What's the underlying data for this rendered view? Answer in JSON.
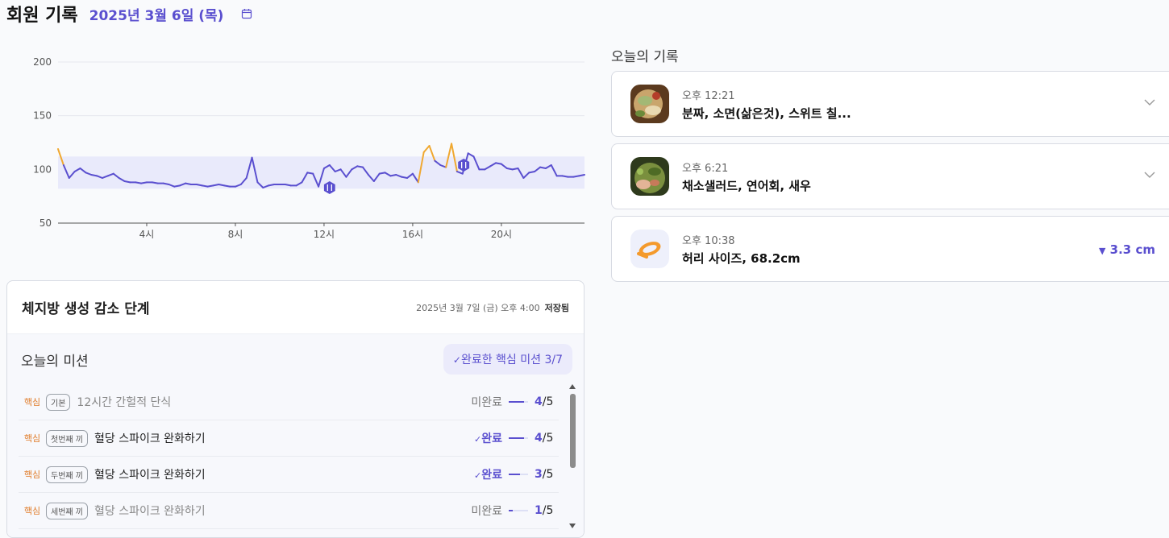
{
  "header": {
    "title": "회원 기록",
    "date": "2025년 3월 6일 (목)"
  },
  "chart_data": {
    "type": "line",
    "y_ticks": [
      "200",
      "150",
      "100",
      "50"
    ],
    "x_ticks": [
      "4시",
      "8시",
      "12시",
      "16시",
      "20시"
    ],
    "ylim": [
      50,
      200
    ],
    "target_band": [
      82,
      112
    ],
    "x": [
      0,
      0.25,
      0.5,
      0.75,
      1,
      1.25,
      1.5,
      1.75,
      2,
      2.25,
      2.5,
      2.75,
      3,
      3.25,
      3.5,
      3.75,
      4,
      4.25,
      4.5,
      4.75,
      5,
      5.25,
      5.5,
      5.75,
      6,
      6.25,
      6.5,
      6.75,
      7,
      7.25,
      7.5,
      7.75,
      8,
      8.25,
      8.5,
      8.75,
      9,
      9.25,
      9.5,
      9.75,
      10,
      10.25,
      10.5,
      10.75,
      11,
      11.25,
      11.5,
      11.75,
      12,
      12.25,
      12.5,
      12.75,
      13,
      13.25,
      13.5,
      13.75,
      14,
      14.25,
      14.5,
      14.75,
      15,
      15.25,
      15.5,
      15.75,
      16,
      16.25,
      16.5,
      16.75,
      17,
      17.25,
      17.5,
      17.75,
      18,
      18.25,
      18.5,
      18.75,
      19,
      19.25,
      19.5,
      19.75,
      20,
      20.25,
      20.5,
      20.75,
      21,
      21.25,
      21.5,
      21.75,
      22,
      22.25,
      22.5,
      22.75,
      23,
      23.25,
      23.5,
      23.75
    ],
    "values": [
      119,
      104,
      92,
      98,
      101,
      97,
      95,
      94,
      92,
      94,
      96,
      92,
      89,
      88,
      88,
      87,
      88,
      88,
      87,
      87,
      86,
      84,
      85,
      87,
      86,
      86,
      85,
      84,
      85,
      86,
      85,
      84,
      84,
      86,
      92,
      111,
      88,
      83,
      85,
      86,
      86,
      86,
      85,
      85,
      88,
      97,
      96,
      84,
      101,
      104,
      98,
      100,
      93,
      100,
      103,
      102,
      95,
      89,
      96,
      97,
      94,
      95,
      93,
      92,
      96,
      88,
      116,
      122,
      108,
      104,
      102,
      124,
      98,
      96,
      115,
      112,
      100,
      100,
      103,
      106,
      105,
      101,
      100,
      101,
      92,
      97,
      98,
      102,
      101,
      104,
      94,
      94,
      93,
      93,
      94,
      95
    ],
    "markers": [
      {
        "hour": 12.25,
        "value": 83
      },
      {
        "hour": 18.3,
        "value": 104
      }
    ]
  },
  "panel": {
    "title": "체지방 생성 감소 단계",
    "meta": "2025년 3월 7일 (금) 오후 4:00",
    "saved": "저장됨"
  },
  "mission": {
    "title": "오늘의 미션",
    "badge": "완료한 핵심 미션 3/7",
    "rows": [
      {
        "core": "핵심",
        "tag": "기본",
        "name": "12시간 간헐적 단식",
        "status": "미완료",
        "done": 4,
        "total": "5",
        "complete": false
      },
      {
        "core": "핵심",
        "tag": "첫번째 끼",
        "name": "혈당 스파이크 완화하기",
        "status": "완료",
        "done": 4,
        "total": "5",
        "complete": true
      },
      {
        "core": "핵심",
        "tag": "두번째 끼",
        "name": "혈당 스파이크 완화하기",
        "status": "완료",
        "done": 3,
        "total": "5",
        "complete": true
      },
      {
        "core": "핵심",
        "tag": "세번째 끼",
        "name": "혈당 스파이크 완화하기",
        "status": "미완료",
        "done": 1,
        "total": "5",
        "complete": false
      }
    ]
  },
  "records": {
    "title": "오늘의 기록",
    "items": [
      {
        "time": "오후 12:21",
        "name": "분짜, 소면(삶은것), 스위트 칠..."
      },
      {
        "time": "오후 6:21",
        "name": "채소샐러드, 연어회, 새우"
      },
      {
        "time": "오후 10:38",
        "name": "허리 사이즈, 68.2cm",
        "delta": "3.3 cm"
      }
    ]
  },
  "colors": {
    "accent": "#5a4fcf",
    "high": "#f0a830",
    "band": "#e9eafb",
    "core": "#e07b28"
  }
}
